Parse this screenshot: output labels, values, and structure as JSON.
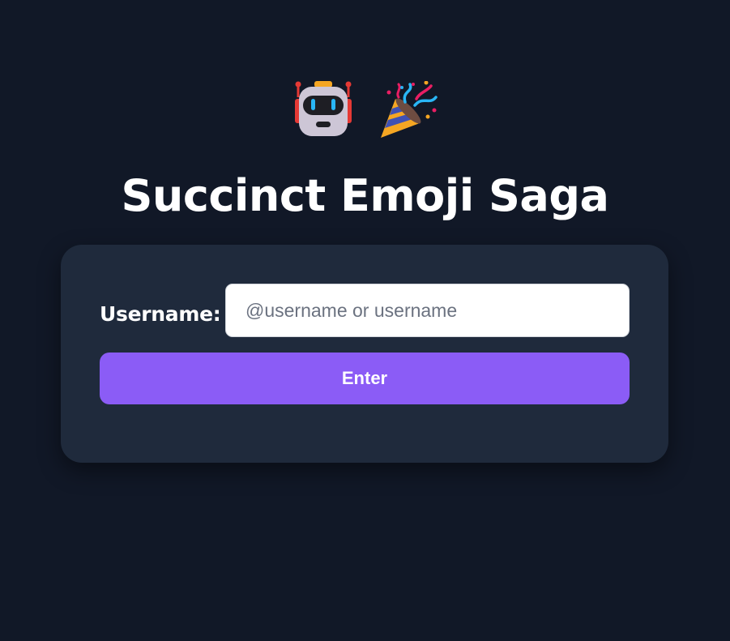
{
  "header": {
    "emojis": [
      "robot-icon",
      "party-popper-icon"
    ],
    "title": "Succinct Emoji Saga"
  },
  "login_form": {
    "username_label": "Username:",
    "username_value": "",
    "username_placeholder": "@username or username",
    "enter_label": "Enter"
  },
  "colors": {
    "background": "#111827",
    "card": "#1f2a3c",
    "accent": "#8b5cf6",
    "text": "#ffffff"
  }
}
